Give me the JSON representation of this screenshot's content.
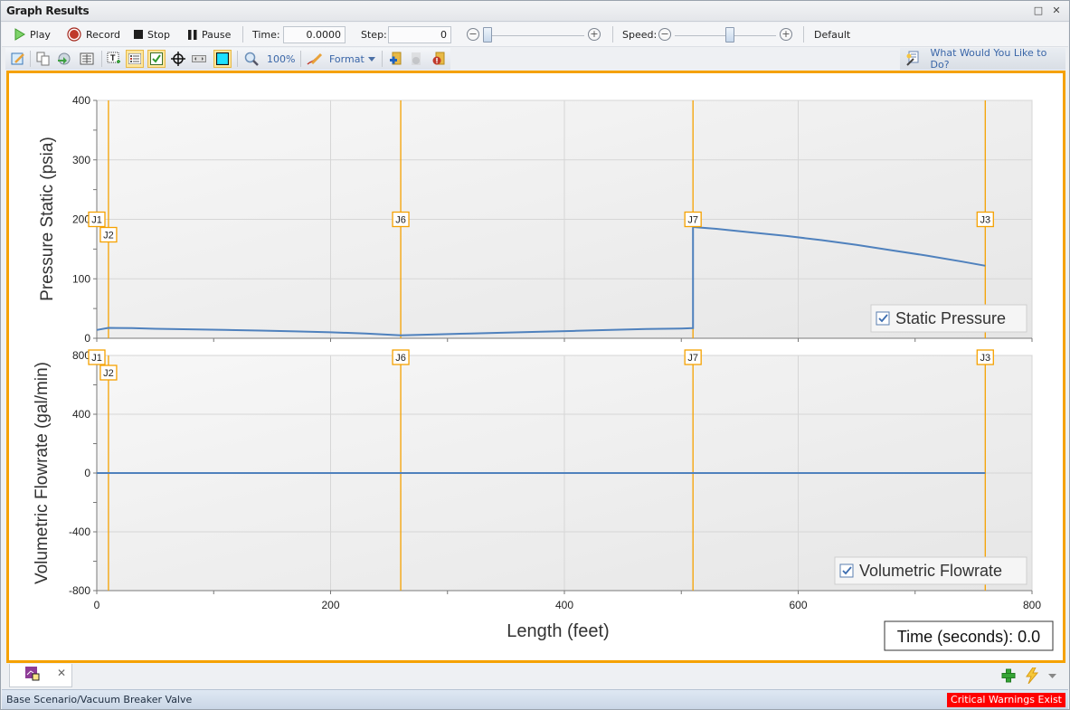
{
  "window": {
    "title": "Graph Results",
    "restore_glyph": "□",
    "close_glyph": "✕"
  },
  "playback": {
    "play_label": "Play",
    "record_label": "Record",
    "stop_label": "Stop",
    "pause_label": "Pause",
    "time_label": "Time:",
    "time_value": "0.0000",
    "step_label": "Step:",
    "step_value": "0",
    "speed_label": "Speed:",
    "default_label": "Default",
    "time_slider_position": 0.0,
    "speed_slider_position": 0.55
  },
  "toolbar": {
    "zoom_value": "100%",
    "format_label": "Format",
    "help_label": "What Would You Like to Do?",
    "items": [
      "edit-graph-icon",
      "copy-icon",
      "export-icon",
      "table-view-icon",
      "add-text-icon",
      "legend-icon",
      "checkbox-icon",
      "crosshair-icon",
      "scrollbar-icon",
      "background-color-icon",
      "zoom-icon",
      "format-icon",
      "add-junction-icon",
      "disabled-icon",
      "warning-icon"
    ]
  },
  "chart_data": [
    {
      "type": "line",
      "title": "",
      "xlabel": "Length (feet)",
      "ylabel": "Pressure Static (psia)",
      "xlim": [
        0,
        800
      ],
      "ylim": [
        0,
        400
      ],
      "xticks": [
        "0",
        "200",
        "400",
        "600",
        "800"
      ],
      "yticks": [
        "0",
        "100",
        "200",
        "300",
        "400"
      ],
      "grid": true,
      "legend": "bottom-right",
      "series": [
        {
          "name": "Static Pressure",
          "color": "#4f81bd",
          "x": [
            0,
            10,
            30,
            50,
            80,
            110,
            140,
            170,
            200,
            230,
            260,
            290,
            320,
            350,
            380,
            410,
            440,
            470,
            500,
            510,
            510,
            530,
            560,
            590,
            620,
            650,
            680,
            710,
            740,
            760
          ],
          "y": [
            14,
            17.5,
            17,
            16,
            15,
            14,
            13,
            11.5,
            10,
            8,
            5,
            6.5,
            8,
            9.5,
            11,
            12.5,
            14,
            15.5,
            16.5,
            17,
            187,
            184,
            178,
            172,
            165,
            157,
            148,
            139,
            129,
            122
          ]
        }
      ],
      "markers": [
        {
          "label": "J1",
          "x": 0
        },
        {
          "label": "J2",
          "x": 10
        },
        {
          "label": "J6",
          "x": 260
        },
        {
          "label": "J7",
          "x": 510
        },
        {
          "label": "J3",
          "x": 760
        }
      ]
    },
    {
      "type": "line",
      "title": "",
      "xlabel": "Length (feet)",
      "ylabel": "Volumetric Flowrate (gal/min)",
      "xlim": [
        0,
        800
      ],
      "ylim": [
        -800,
        800
      ],
      "xticks": [
        "0",
        "200",
        "400",
        "600",
        "800"
      ],
      "yticks": [
        "-800",
        "-400",
        "0",
        "400",
        "800"
      ],
      "grid": true,
      "legend": "bottom-right",
      "series": [
        {
          "name": "Volumetric Flowrate",
          "color": "#4f81bd",
          "x": [
            0,
            10,
            260,
            510,
            760
          ],
          "y": [
            0,
            0,
            0,
            0,
            0
          ]
        }
      ],
      "markers": [
        {
          "label": "J1",
          "x": 0
        },
        {
          "label": "J2",
          "x": 10
        },
        {
          "label": "J6",
          "x": 260
        },
        {
          "label": "J7",
          "x": 510
        },
        {
          "label": "J3",
          "x": 760
        }
      ]
    }
  ],
  "time_readout": "Time (seconds): 0.0",
  "colors": {
    "accent_frame": "#f5a100",
    "marker": "#f5a100",
    "series": "#4f81bd",
    "critical": "#ff0000"
  },
  "bottom": {
    "tab_close_glyph": "✕",
    "status_text": "Base Scenario/Vacuum Breaker Valve",
    "critical_text": "Critical Warnings Exist"
  }
}
